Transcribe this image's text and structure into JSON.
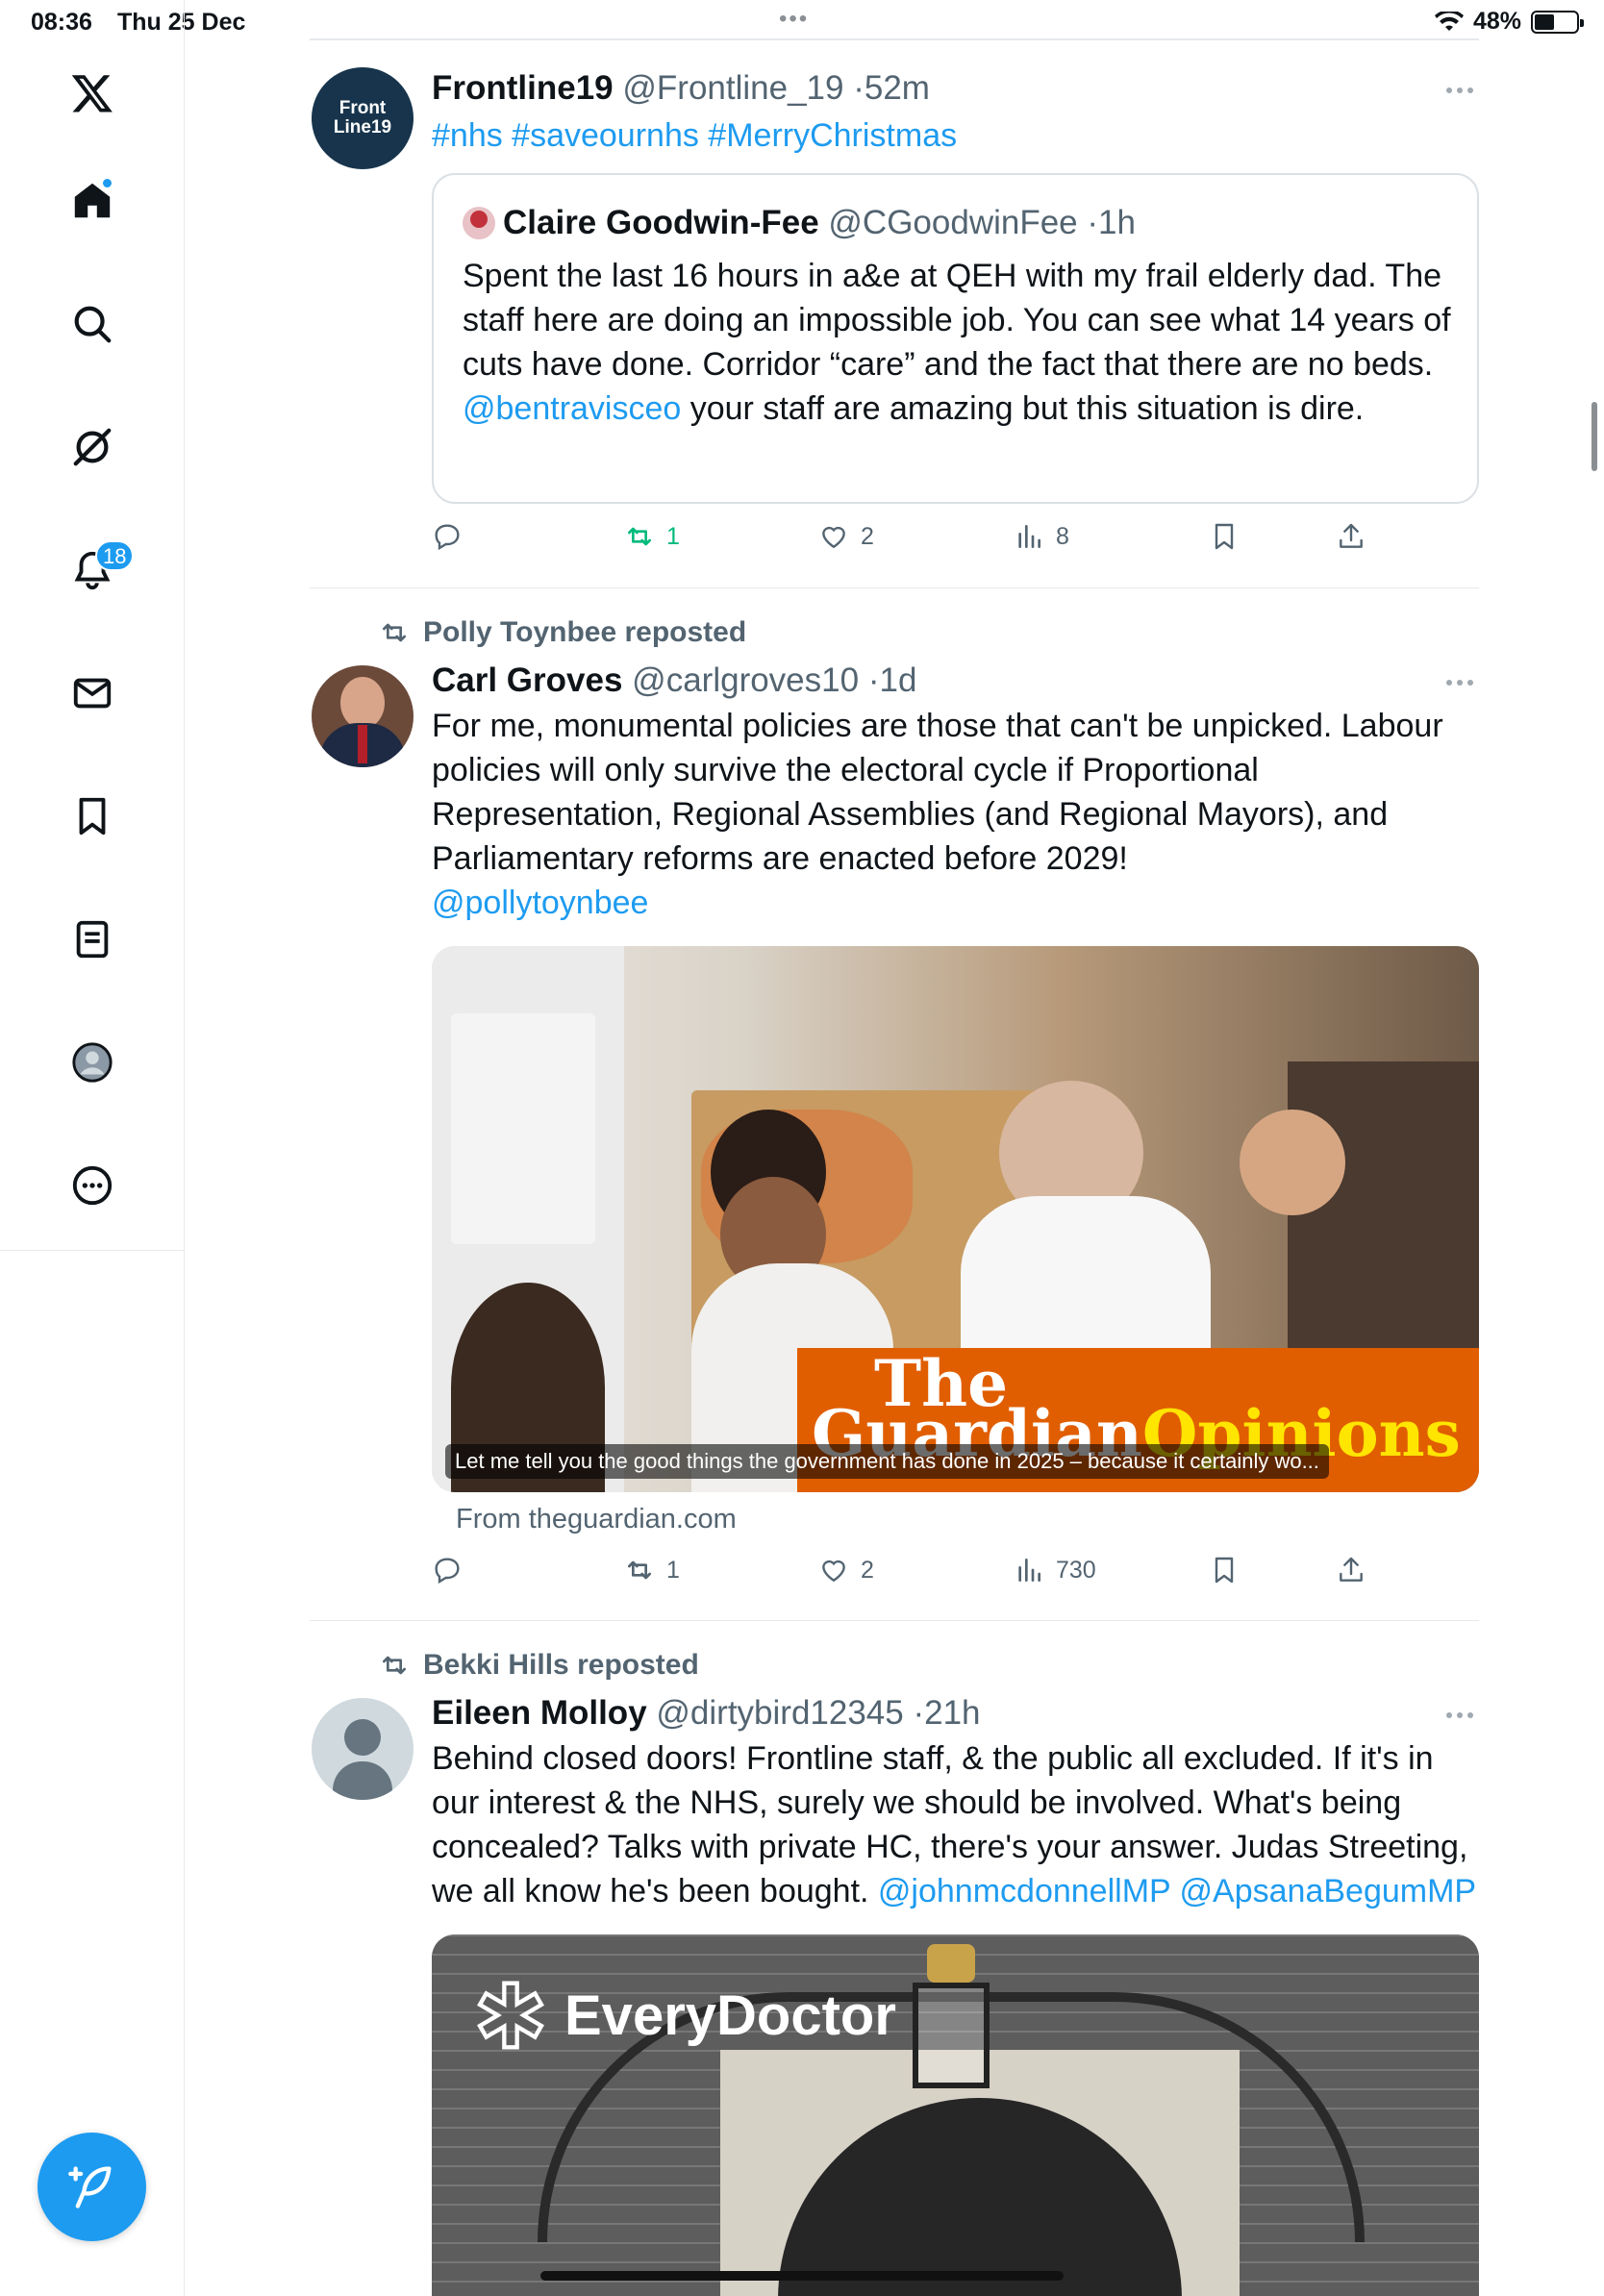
{
  "status": {
    "time": "08:36",
    "date": "Thu 25 Dec",
    "battery": "48%",
    "battery_level": 0.48
  },
  "sidebar": {
    "notifications_count": "18"
  },
  "tweets": [
    {
      "name": "Frontline19",
      "handle": "@Frontline_19",
      "time": "52m",
      "hashtags": "#nhs #saveournhs #MerryChristmas",
      "avatar_text": "Front Line19",
      "quote": {
        "name": "Claire Goodwin-Fee",
        "handle": "@CGoodwinFee",
        "time": "1h",
        "text_1": "Spent the last 16 hours in a&e at QEH with my frail elderly dad.  The staff here are doing an impossible job.  You can see what 14 years of cuts have done.   Corridor “care” and the fact that there are no beds. ",
        "mention": "@bentravisceo",
        "text_2": "  your staff are amazing but this situation is dire."
      },
      "stats": {
        "replies": "",
        "reposts": "1",
        "likes": "2",
        "views": "8"
      }
    },
    {
      "reposted_by": "Polly Toynbee reposted",
      "name": "Carl Groves",
      "handle": "@carlgroves10",
      "time": "1d",
      "text": "For me, monumental policies are those that can't be unpicked. Labour policies will only survive the electoral cycle if Proportional Representation, Regional Assemblies (and Regional Mayors), and Parliamentary reforms are enacted before 2029!",
      "mention": "@pollytoynbee",
      "card": {
        "logo_line1": "The",
        "logo_line2": "Guardian",
        "logo_line3": "Opinions",
        "caption": "Let me tell you the good things the government has done in 2025 – because it certainly wo...",
        "source": "From theguardian.com"
      },
      "stats": {
        "replies": "",
        "reposts": "1",
        "likes": "2",
        "views": "730"
      }
    },
    {
      "reposted_by": "Bekki Hills reposted",
      "name": "Eileen Molloy",
      "handle": "@dirtybird12345",
      "time": "21h",
      "text": "Behind closed doors! Frontline staff, & the public all excluded. If it's in our interest & the NHS, surely we should be involved. What's being concealed? Talks with private HC, there's your answer. Judas Streeting, we all know he's been bought. ",
      "mention1": "@johnmcdonnellMP",
      "mention2": "@ApsanaBegumMP",
      "image_logo": "EveryDoctor"
    }
  ],
  "colors": {
    "accent": "#1d9bf0",
    "repost_green": "#00ba7c",
    "muted": "#536471",
    "guardian_orange": "#e05e00",
    "guardian_yellow": "#ffe500"
  }
}
